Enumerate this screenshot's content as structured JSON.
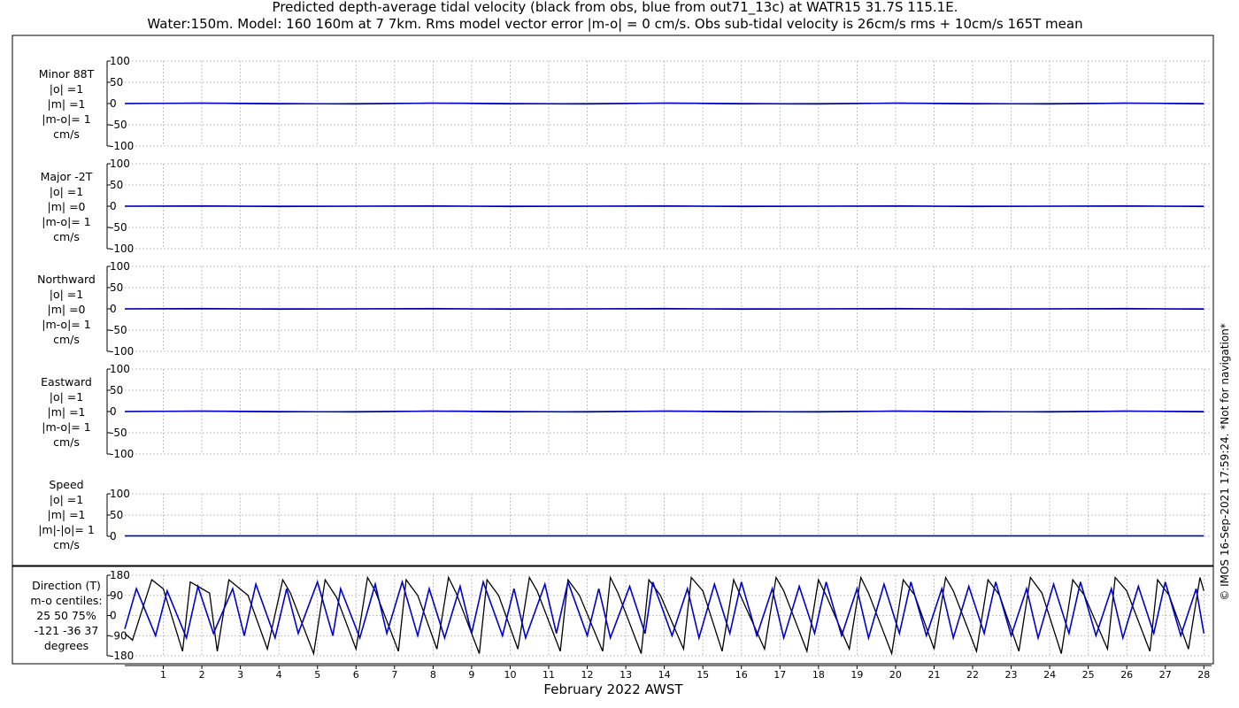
{
  "title_line1": "Predicted depth-average tidal velocity (black from obs, blue from out71_13c) at WATR15 31.7S 115.1E.",
  "title_line2": "Water:150m. Model: 160 160m at 7 7km. Rms model vector error |m-o| = 0 cm/s. Obs sub-tidal velocity is 26cm/s rms + 10cm/s 165T mean",
  "copyright": "© IMOS 16-Sep-2021 17:59:24. *Not for navigation*",
  "colors": {
    "obs": "#000000",
    "model": "#0000cc",
    "grid": "#9a9a9a",
    "frame": "#000000"
  },
  "chart_data": [
    {
      "type": "line",
      "panel": "Minor 88T",
      "label_lines": [
        "Minor 88T",
        "|o| =1",
        "|m| =1",
        "|m-o|= 1",
        "cm/s"
      ],
      "ylim": [
        -100,
        100
      ],
      "yticks": [
        "100",
        "50",
        "0",
        "-50",
        "-100"
      ],
      "yticks_values": [
        100,
        50,
        0,
        -50,
        -100
      ],
      "series": [
        {
          "color": "#000000",
          "x": [
            0,
            2,
            4,
            6,
            8,
            10,
            12,
            14,
            16,
            18,
            20,
            22,
            24,
            26,
            28
          ],
          "y": [
            0,
            1,
            -1,
            0,
            1,
            -1,
            0,
            1,
            -1,
            0,
            1,
            -1,
            0,
            1,
            -1
          ]
        },
        {
          "color": "#0000cc",
          "x": [
            0,
            2,
            4,
            6,
            8,
            10,
            12,
            14,
            16,
            18,
            20,
            22,
            24,
            26,
            28
          ],
          "y": [
            0,
            1,
            0,
            -1,
            1,
            0,
            -1,
            1,
            0,
            -1,
            1,
            0,
            -1,
            1,
            0
          ]
        }
      ]
    },
    {
      "type": "line",
      "panel": "Major -2T",
      "label_lines": [
        "Major -2T",
        "|o| =1",
        "|m| =0",
        "|m-o|= 1",
        "cm/s"
      ],
      "ylim": [
        -100,
        100
      ],
      "yticks": [
        "100",
        "50",
        "0",
        "-50",
        "-100"
      ],
      "yticks_values": [
        100,
        50,
        0,
        -50,
        -100
      ],
      "series": [
        {
          "color": "#000000",
          "x": [
            0,
            2,
            4,
            6,
            8,
            10,
            12,
            14,
            16,
            18,
            20,
            22,
            24,
            26,
            28
          ],
          "y": [
            0,
            1,
            -1,
            0,
            1,
            -1,
            0,
            1,
            -1,
            0,
            1,
            -1,
            0,
            1,
            -1
          ]
        },
        {
          "color": "#0000cc",
          "x": [
            0,
            28
          ],
          "y": [
            0,
            0
          ]
        }
      ]
    },
    {
      "type": "line",
      "panel": "Northward",
      "label_lines": [
        "Northward",
        "|o| =1",
        "|m| =0",
        "|m-o|= 1",
        "cm/s"
      ],
      "ylim": [
        -100,
        100
      ],
      "yticks": [
        "100",
        "50",
        "0",
        "-50",
        "-100"
      ],
      "yticks_values": [
        100,
        50,
        0,
        -50,
        -100
      ],
      "series": [
        {
          "color": "#000000",
          "x": [
            0,
            2,
            4,
            6,
            8,
            10,
            12,
            14,
            16,
            18,
            20,
            22,
            24,
            26,
            28
          ],
          "y": [
            0,
            1,
            -1,
            0,
            1,
            -1,
            0,
            1,
            -1,
            0,
            1,
            -1,
            0,
            1,
            -1
          ]
        },
        {
          "color": "#0000cc",
          "x": [
            0,
            28
          ],
          "y": [
            0,
            0
          ]
        }
      ]
    },
    {
      "type": "line",
      "panel": "Eastward",
      "label_lines": [
        "Eastward",
        "|o| =1",
        "|m| =1",
        "|m-o|= 1",
        "cm/s"
      ],
      "ylim": [
        -100,
        100
      ],
      "yticks": [
        "100",
        "50",
        "0",
        "-50",
        "-100"
      ],
      "yticks_values": [
        100,
        50,
        0,
        -50,
        -100
      ],
      "series": [
        {
          "color": "#000000",
          "x": [
            0,
            2,
            4,
            6,
            8,
            10,
            12,
            14,
            16,
            18,
            20,
            22,
            24,
            26,
            28
          ],
          "y": [
            0,
            1,
            -1,
            0,
            1,
            -1,
            0,
            1,
            -1,
            0,
            1,
            -1,
            0,
            1,
            -1
          ]
        },
        {
          "color": "#0000cc",
          "x": [
            0,
            2,
            4,
            6,
            8,
            10,
            12,
            14,
            16,
            18,
            20,
            22,
            24,
            26,
            28
          ],
          "y": [
            0,
            1,
            0,
            -1,
            1,
            0,
            -1,
            1,
            0,
            -1,
            1,
            0,
            -1,
            1,
            0
          ]
        }
      ]
    },
    {
      "type": "line",
      "panel": "Speed",
      "label_lines": [
        "Speed",
        "|o| =1",
        "|m| =1",
        "|m|-|o|= 1",
        "cm/s"
      ],
      "ylim": [
        0,
        100
      ],
      "yticks": [
        "100",
        "50",
        "0"
      ],
      "yticks_values": [
        100,
        50,
        0
      ],
      "series": [
        {
          "color": "#000000",
          "x": [
            0,
            4,
            8,
            12,
            16,
            20,
            24,
            28
          ],
          "y": [
            1,
            1,
            1,
            1,
            1,
            1,
            1,
            1
          ]
        },
        {
          "color": "#0000cc",
          "x": [
            0,
            4,
            8,
            12,
            16,
            20,
            24,
            28
          ],
          "y": [
            1,
            1,
            1,
            1,
            1,
            1,
            1,
            1
          ]
        }
      ]
    },
    {
      "type": "line",
      "panel": "Direction (T)",
      "label_lines": [
        "Direction (T)",
        "m-o centiles:",
        "25  50  75%",
        "-121  -36  37",
        "degrees"
      ],
      "ylim": [
        -180,
        180
      ],
      "yticks": [
        "180",
        "90",
        "0",
        "-90",
        "-180"
      ],
      "yticks_values": [
        180,
        90,
        0,
        -90,
        -180
      ],
      "series": [
        {
          "color": "#000000",
          "x": [
            0,
            0.2,
            0.7,
            1.0,
            1.5,
            1.7,
            2.2,
            2.4,
            2.7,
            3.2,
            3.7,
            4.1,
            4.3,
            4.9,
            5.2,
            5.5,
            6.0,
            6.3,
            6.5,
            7.1,
            7.3,
            7.6,
            8.1,
            8.4,
            8.6,
            9.2,
            9.4,
            9.7,
            10.2,
            10.5,
            10.7,
            11.3,
            11.5,
            11.8,
            12.4,
            12.6,
            12.8,
            13.4,
            13.6,
            13.9,
            14.5,
            14.7,
            15.0,
            15.5,
            15.8,
            16.0,
            16.6,
            16.9,
            17.1,
            17.7,
            18.0,
            18.2,
            18.8,
            19.1,
            19.3,
            19.9,
            20.2,
            20.5,
            21.0,
            21.3,
            21.5,
            22.1,
            22.4,
            22.7,
            23.2,
            23.5,
            23.8,
            24.3,
            24.6,
            24.9,
            25.5,
            25.7,
            26.0,
            26.6,
            26.8,
            27.1,
            27.6,
            27.9,
            28.0
          ],
          "y": [
            -80,
            -110,
            160,
            120,
            -160,
            150,
            100,
            -160,
            160,
            90,
            -150,
            160,
            100,
            -170,
            160,
            80,
            -150,
            170,
            110,
            -160,
            160,
            90,
            -150,
            170,
            100,
            -170,
            160,
            90,
            -150,
            170,
            110,
            -160,
            160,
            90,
            -160,
            170,
            100,
            -170,
            160,
            90,
            -150,
            170,
            110,
            -160,
            160,
            80,
            -150,
            170,
            110,
            -160,
            160,
            90,
            -150,
            170,
            100,
            -170,
            160,
            90,
            -150,
            170,
            110,
            -160,
            160,
            90,
            -160,
            170,
            100,
            -170,
            160,
            90,
            -150,
            170,
            110,
            -160,
            160,
            90,
            -150,
            170,
            110
          ]
        },
        {
          "color": "#0000cc",
          "x": [
            0,
            0.3,
            0.8,
            1.1,
            1.6,
            1.9,
            2.3,
            2.8,
            3.1,
            3.4,
            3.9,
            4.2,
            4.5,
            5.0,
            5.4,
            5.6,
            6.1,
            6.5,
            6.8,
            7.2,
            7.6,
            7.9,
            8.3,
            8.7,
            9.0,
            9.3,
            9.8,
            10.1,
            10.4,
            10.9,
            11.2,
            11.5,
            12.0,
            12.3,
            12.6,
            13.1,
            13.5,
            13.7,
            14.2,
            14.6,
            14.9,
            15.3,
            15.7,
            16.0,
            16.4,
            16.8,
            17.1,
            17.5,
            17.9,
            18.2,
            18.6,
            19.0,
            19.3,
            19.7,
            20.1,
            20.4,
            20.8,
            21.2,
            21.5,
            21.9,
            22.3,
            22.6,
            23.0,
            23.4,
            23.7,
            24.1,
            24.5,
            24.8,
            25.2,
            25.6,
            25.9,
            26.3,
            26.7,
            27.0,
            27.4,
            27.8,
            28.0
          ],
          "y": [
            -60,
            120,
            -90,
            110,
            -100,
            130,
            -80,
            120,
            -90,
            140,
            -100,
            120,
            -80,
            150,
            -90,
            120,
            -100,
            140,
            -80,
            150,
            -90,
            120,
            -100,
            130,
            -80,
            150,
            -90,
            120,
            -100,
            140,
            -80,
            150,
            -90,
            120,
            -100,
            130,
            -80,
            150,
            -90,
            120,
            -100,
            140,
            -80,
            150,
            -90,
            120,
            -100,
            130,
            -80,
            150,
            -90,
            120,
            -100,
            140,
            -80,
            150,
            -90,
            120,
            -100,
            130,
            -80,
            150,
            -90,
            120,
            -100,
            140,
            -80,
            150,
            -90,
            120,
            -100,
            130,
            -80,
            150,
            -90,
            120,
            -80
          ]
        }
      ]
    }
  ],
  "xticks": [
    "1",
    "2",
    "3",
    "4",
    "5",
    "6",
    "7",
    "8",
    "9",
    "10",
    "11",
    "12",
    "13",
    "14",
    "15",
    "16",
    "17",
    "18",
    "19",
    "20",
    "21",
    "22",
    "23",
    "24",
    "25",
    "26",
    "27",
    "28"
  ],
  "xticks_values": [
    1,
    2,
    3,
    4,
    5,
    6,
    7,
    8,
    9,
    10,
    11,
    12,
    13,
    14,
    15,
    16,
    17,
    18,
    19,
    20,
    21,
    22,
    23,
    24,
    25,
    26,
    27,
    28
  ],
  "xlim": [
    0,
    28.2
  ],
  "xlabel": "February 2022 AWST"
}
